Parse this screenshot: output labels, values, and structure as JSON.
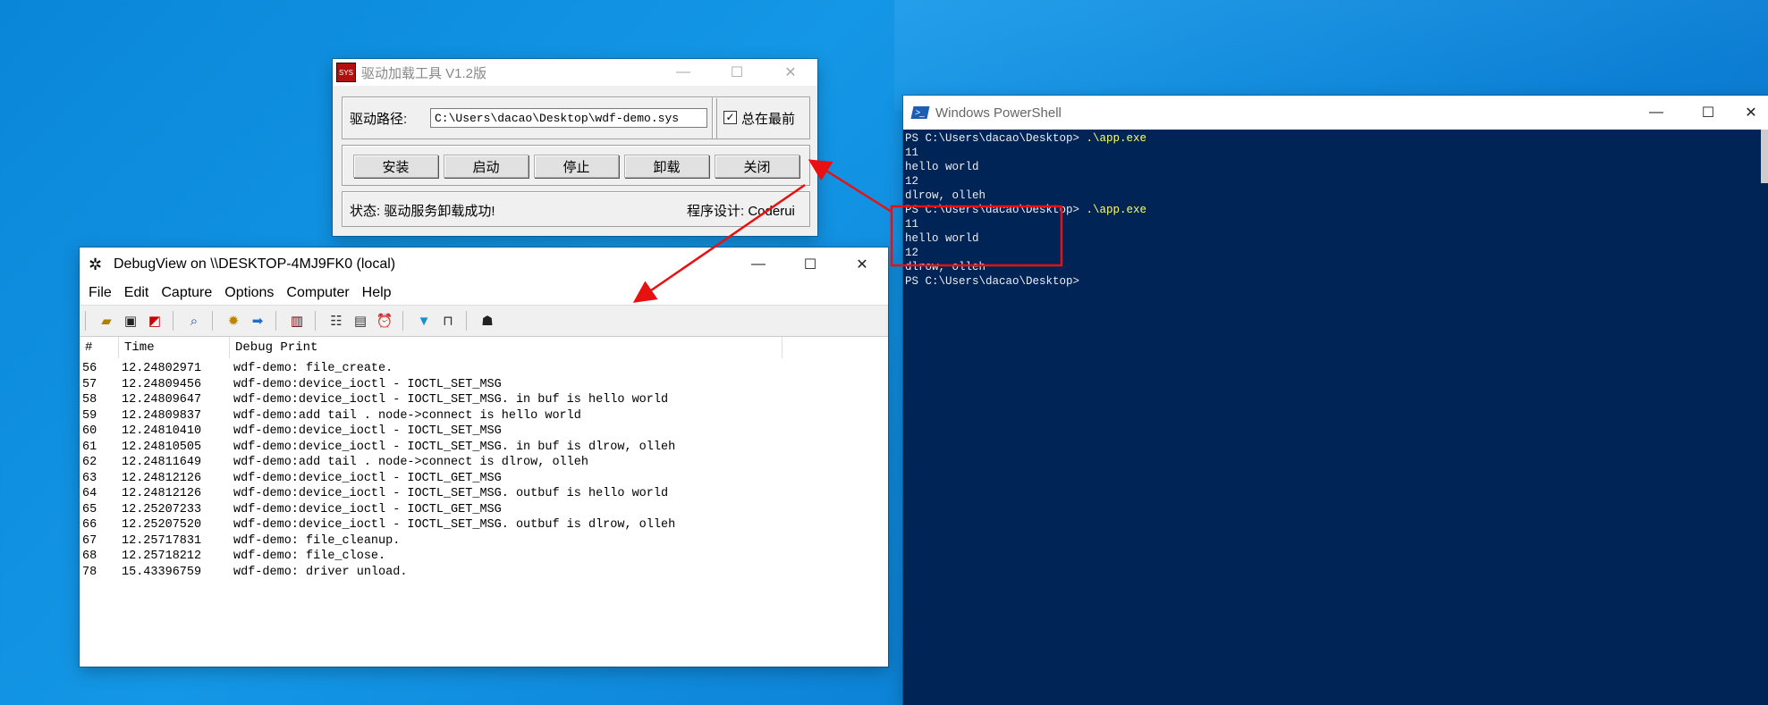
{
  "colors": {
    "accent_red": "#e81010",
    "ps_background": "#012456",
    "ps_command": "#ffff60"
  },
  "loader": {
    "title": "驱动加载工具 V1.2版",
    "icon_text": "SYS",
    "path_label": "驱动路径:",
    "path_value": "C:\\Users\\dacao\\Desktop\\wdf-demo.sys",
    "checkbox_label": "总在最前",
    "buttons": [
      "安装",
      "启动",
      "停止",
      "卸载",
      "关闭"
    ],
    "status": "状态: 驱动服务卸载成功!",
    "designer": "程序设计: Coderui"
  },
  "debugview": {
    "title": "DebugView on \\\\DESKTOP-4MJ9FK0 (local)",
    "menu": [
      "File",
      "Edit",
      "Capture",
      "Options",
      "Computer",
      "Help"
    ],
    "columns": [
      "#",
      "Time",
      "Debug Print"
    ],
    "rows": [
      [
        "56",
        "12.24802971",
        "wdf-demo: file_create."
      ],
      [
        "57",
        "12.24809456",
        "wdf-demo:device_ioctl - IOCTL_SET_MSG"
      ],
      [
        "58",
        "12.24809647",
        "wdf-demo:device_ioctl - IOCTL_SET_MSG. in buf is hello world"
      ],
      [
        "59",
        "12.24809837",
        "wdf-demo:add tail . node->connect is hello world"
      ],
      [
        "60",
        "12.24810410",
        "wdf-demo:device_ioctl - IOCTL_SET_MSG"
      ],
      [
        "61",
        "12.24810505",
        "wdf-demo:device_ioctl - IOCTL_SET_MSG. in buf is dlrow, olleh"
      ],
      [
        "62",
        "12.24811649",
        "wdf-demo:add tail . node->connect is dlrow, olleh"
      ],
      [
        "63",
        "12.24812126",
        "wdf-demo:device_ioctl - IOCTL_GET_MSG"
      ],
      [
        "64",
        "12.24812126",
        "wdf-demo:device_ioctl - IOCTL_SET_MSG. outbuf is hello world"
      ],
      [
        "65",
        "12.25207233",
        "wdf-demo:device_ioctl - IOCTL_GET_MSG"
      ],
      [
        "66",
        "12.25207520",
        "wdf-demo:device_ioctl - IOCTL_SET_MSG. outbuf is dlrow, olleh"
      ],
      [
        "67",
        "12.25717831",
        "wdf-demo: file_cleanup."
      ],
      [
        "68",
        "12.25718212",
        "wdf-demo: file_close."
      ],
      [
        "78",
        "15.43396759",
        "wdf-demo: driver unload."
      ]
    ]
  },
  "powershell": {
    "title": "Windows PowerShell",
    "lines": [
      {
        "prompt": "PS C:\\Users\\dacao\\Desktop> ",
        "cmd": ".\\app.exe"
      },
      {
        "text": "11"
      },
      {
        "text": "hello world"
      },
      {
        "text": "12"
      },
      {
        "text": "dlrow, olleh"
      },
      {
        "prompt": "PS C:\\Users\\dacao\\Desktop> ",
        "cmd": ".\\app.exe"
      },
      {
        "text": "11"
      },
      {
        "text": "hello world"
      },
      {
        "text": "12"
      },
      {
        "text": "dlrow, olleh"
      },
      {
        "prompt": "PS C:\\Users\\dacao\\Desktop>",
        "cmd": ""
      }
    ]
  },
  "window_controls": {
    "minimize": "—",
    "maximize": "☐",
    "close": "✕"
  }
}
